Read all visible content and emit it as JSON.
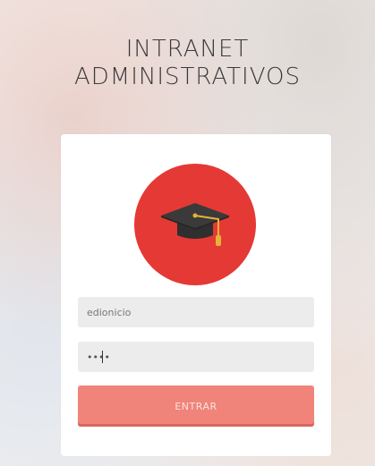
{
  "header": {
    "title_line1": "INTRANET",
    "title_line2": "ADMINISTRATIVOS"
  },
  "login": {
    "avatar_icon": "graduation-cap-icon",
    "avatar_color": "#e53935",
    "username_value": "edionicio",
    "password_value": "••••",
    "submit_label": "ENTRAR",
    "button_color": "#f0837a"
  }
}
